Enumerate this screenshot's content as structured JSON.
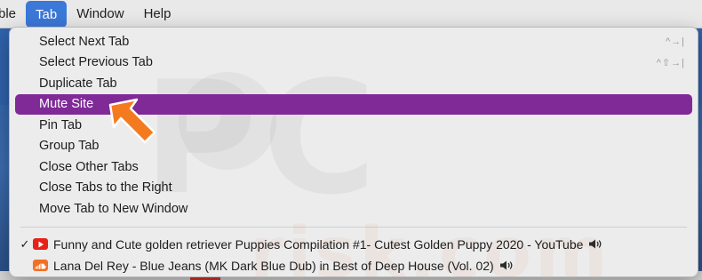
{
  "menubar": {
    "items": [
      {
        "label": "ble"
      },
      {
        "label": "Tab"
      },
      {
        "label": "Window"
      },
      {
        "label": "Help"
      }
    ]
  },
  "tab_menu": {
    "items": [
      {
        "label": "Select Next Tab",
        "shortcut": "^→|"
      },
      {
        "label": "Select Previous Tab",
        "shortcut": "^⇧→|"
      },
      {
        "label": "Duplicate Tab",
        "shortcut": ""
      },
      {
        "label": "Mute Site",
        "shortcut": ""
      },
      {
        "label": "Pin Tab",
        "shortcut": ""
      },
      {
        "label": "Group Tab",
        "shortcut": ""
      },
      {
        "label": "Close Other Tabs",
        "shortcut": ""
      },
      {
        "label": "Close Tabs to the Right",
        "shortcut": ""
      },
      {
        "label": "Move Tab to New Window",
        "shortcut": ""
      }
    ],
    "highlighted_index": 3,
    "open_tabs": [
      {
        "checked": true,
        "favicon": "youtube-icon",
        "title": "Funny and Cute golden retriever Puppies Compilation #1- Cutest Golden Puppy 2020 - YouTube",
        "audio": "speaker-icon"
      },
      {
        "checked": false,
        "favicon": "soundcloud-icon",
        "title": "Lana Del Rey - Blue Jeans (MK Dark Blue Dub) in Best of Deep House (Vol. 02)",
        "audio": "speaker-icon"
      }
    ]
  },
  "colors": {
    "highlight": "#7f2a97",
    "menubar_active": "#3b78d8",
    "arrow": "#f47a20"
  },
  "watermark": {
    "text": "PC",
    "subtext": "risk.com"
  }
}
